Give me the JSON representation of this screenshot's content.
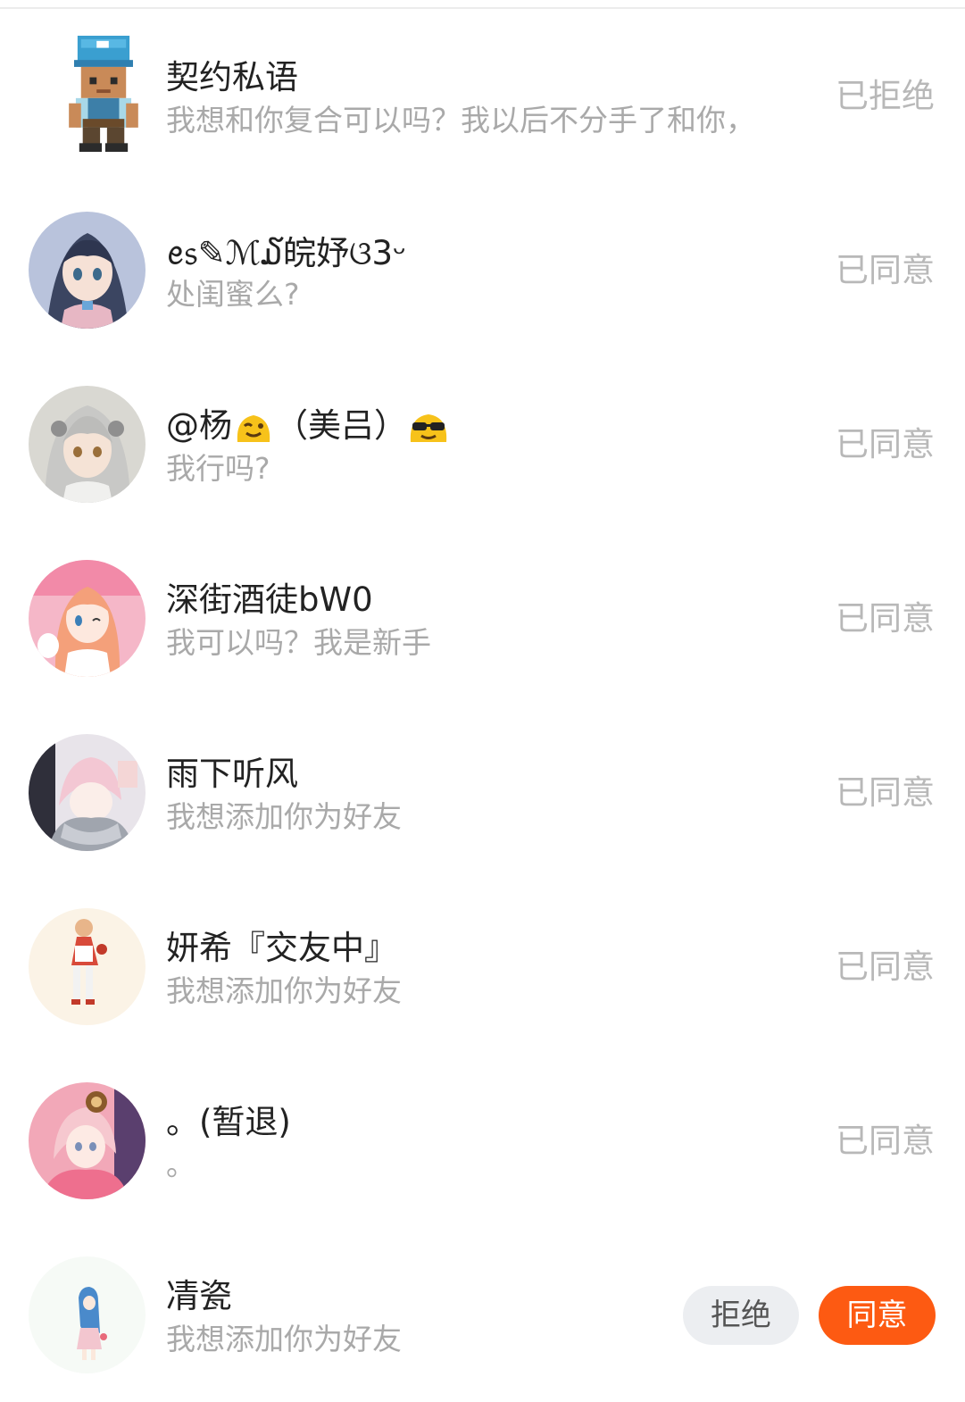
{
  "requests": [
    {
      "name": "契约私语",
      "message": "我想和你复合可以吗？我以后不分手了和你，",
      "status": "已拒绝",
      "avatar": "pixel-character-avatar"
    },
    {
      "name": "ꫀ᥉✎ℳ໓皖妤ଓ3ᵕ",
      "message": "处闺蜜么?",
      "status": "已同意",
      "avatar": "anime-girl-avatar"
    },
    {
      "name_prefix": "@杨",
      "name_middle": "（美吕）",
      "emoji_1": "winking-face-emoji",
      "emoji_2": "sunglasses-face-emoji",
      "message": "我行吗?",
      "status": "已同意",
      "avatar": "anime-silver-hair-avatar"
    },
    {
      "name": "深街酒徒bW0",
      "message": "我可以吗？我是新手",
      "status": "已同意",
      "avatar": "anime-pink-girl-avatar"
    },
    {
      "name": "雨下听风",
      "message": "我想添加你为好友",
      "status": "已同意",
      "avatar": "anime-boy-avatar"
    },
    {
      "name": "妍希『交友中』",
      "message": "我想添加你为好友",
      "status": "已同意",
      "avatar": "anime-chibi-avatar"
    },
    {
      "name": "。(暂退)",
      "message": "。",
      "status": "已同意",
      "avatar": "anime-pink-hoodie-avatar"
    },
    {
      "name": "凊瓷",
      "message": "我想添加你为好友",
      "reject_label": "拒绝",
      "accept_label": "同意",
      "avatar": "anime-blue-hair-avatar"
    }
  ],
  "colors": {
    "accent": "#fd5a12",
    "status_text": "#b8b8b8",
    "message_text": "#a9a9a9",
    "name_text": "#222222"
  }
}
